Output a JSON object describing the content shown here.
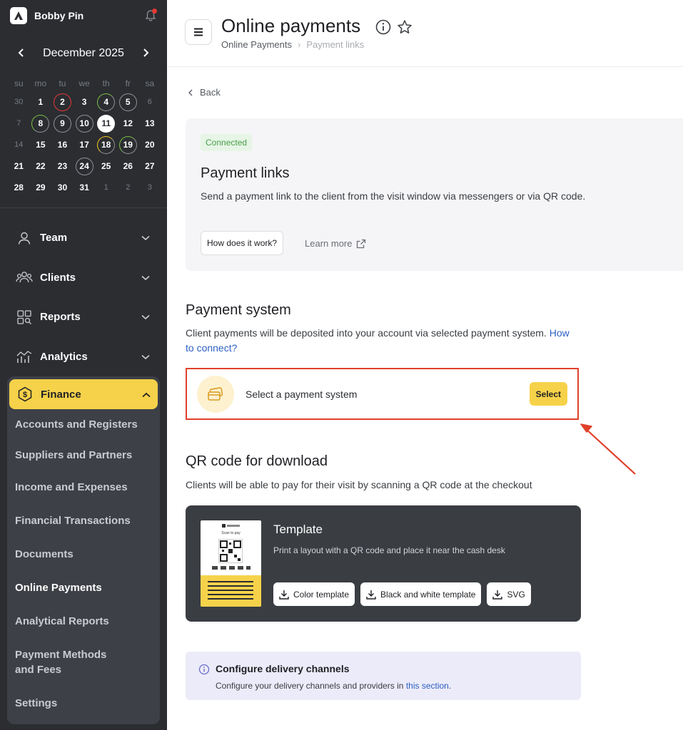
{
  "brand": {
    "name": "Bobby Pin"
  },
  "calendar": {
    "month_label": "December 2025",
    "weekdays": [
      "su",
      "mo",
      "tu",
      "we",
      "th",
      "fr",
      "sa"
    ],
    "weeks": [
      [
        "30",
        "1",
        "2",
        "3",
        "4",
        "5",
        "6"
      ],
      [
        "7",
        "8",
        "9",
        "10",
        "11",
        "12",
        "13"
      ],
      [
        "14",
        "15",
        "16",
        "17",
        "18",
        "19",
        "20"
      ],
      [
        "21",
        "22",
        "23",
        "24",
        "25",
        "26",
        "27"
      ],
      [
        "28",
        "29",
        "30",
        "31",
        "1",
        "2",
        "3"
      ]
    ]
  },
  "nav": {
    "team": "Team",
    "clients": "Clients",
    "reports": "Reports",
    "analytics": "Analytics",
    "finance": "Finance",
    "finance_items": [
      "Accounts and Registers",
      "Suppliers and Partners",
      "Income and Expenses",
      "Financial Transactions",
      "Documents",
      "Online Payments",
      "Analytical Reports",
      "Payment Methods and Fees",
      "Settings"
    ]
  },
  "header": {
    "title": "Online payments",
    "breadcrumb": [
      "Online Payments",
      "Payment links"
    ]
  },
  "back": "Back",
  "payment_links": {
    "badge": "Connected",
    "title": "Payment links",
    "description": "Send a payment link to the client from the visit window via messengers or via QR code.",
    "how_button": "How does it work?",
    "learn_more": "Learn more"
  },
  "payment_system": {
    "title": "Payment system",
    "description": "Client payments will be deposited into your account via selected payment system.",
    "link": "How to connect?",
    "select_label": "Select a payment system",
    "select_button": "Select"
  },
  "qr": {
    "title": "QR code for download",
    "description": "Clients will be able to pay for their visit by scanning a QR code at the checkout",
    "template_title": "Template",
    "template_desc": "Print a layout with a QR code and place it near the cash desk",
    "thumb_caption": "Scan to pay",
    "buttons": [
      "Color template",
      "Black and white template",
      "SVG"
    ]
  },
  "notice": {
    "title": "Configure delivery channels",
    "desc_prefix": "Configure your delivery channels and providers in ",
    "link": "this section",
    "desc_suffix": "."
  },
  "colors": {
    "sidebar": "#2b2d31",
    "accent": "#f6d24a",
    "highlight": "#e0412b",
    "link": "#2c5fc4"
  }
}
